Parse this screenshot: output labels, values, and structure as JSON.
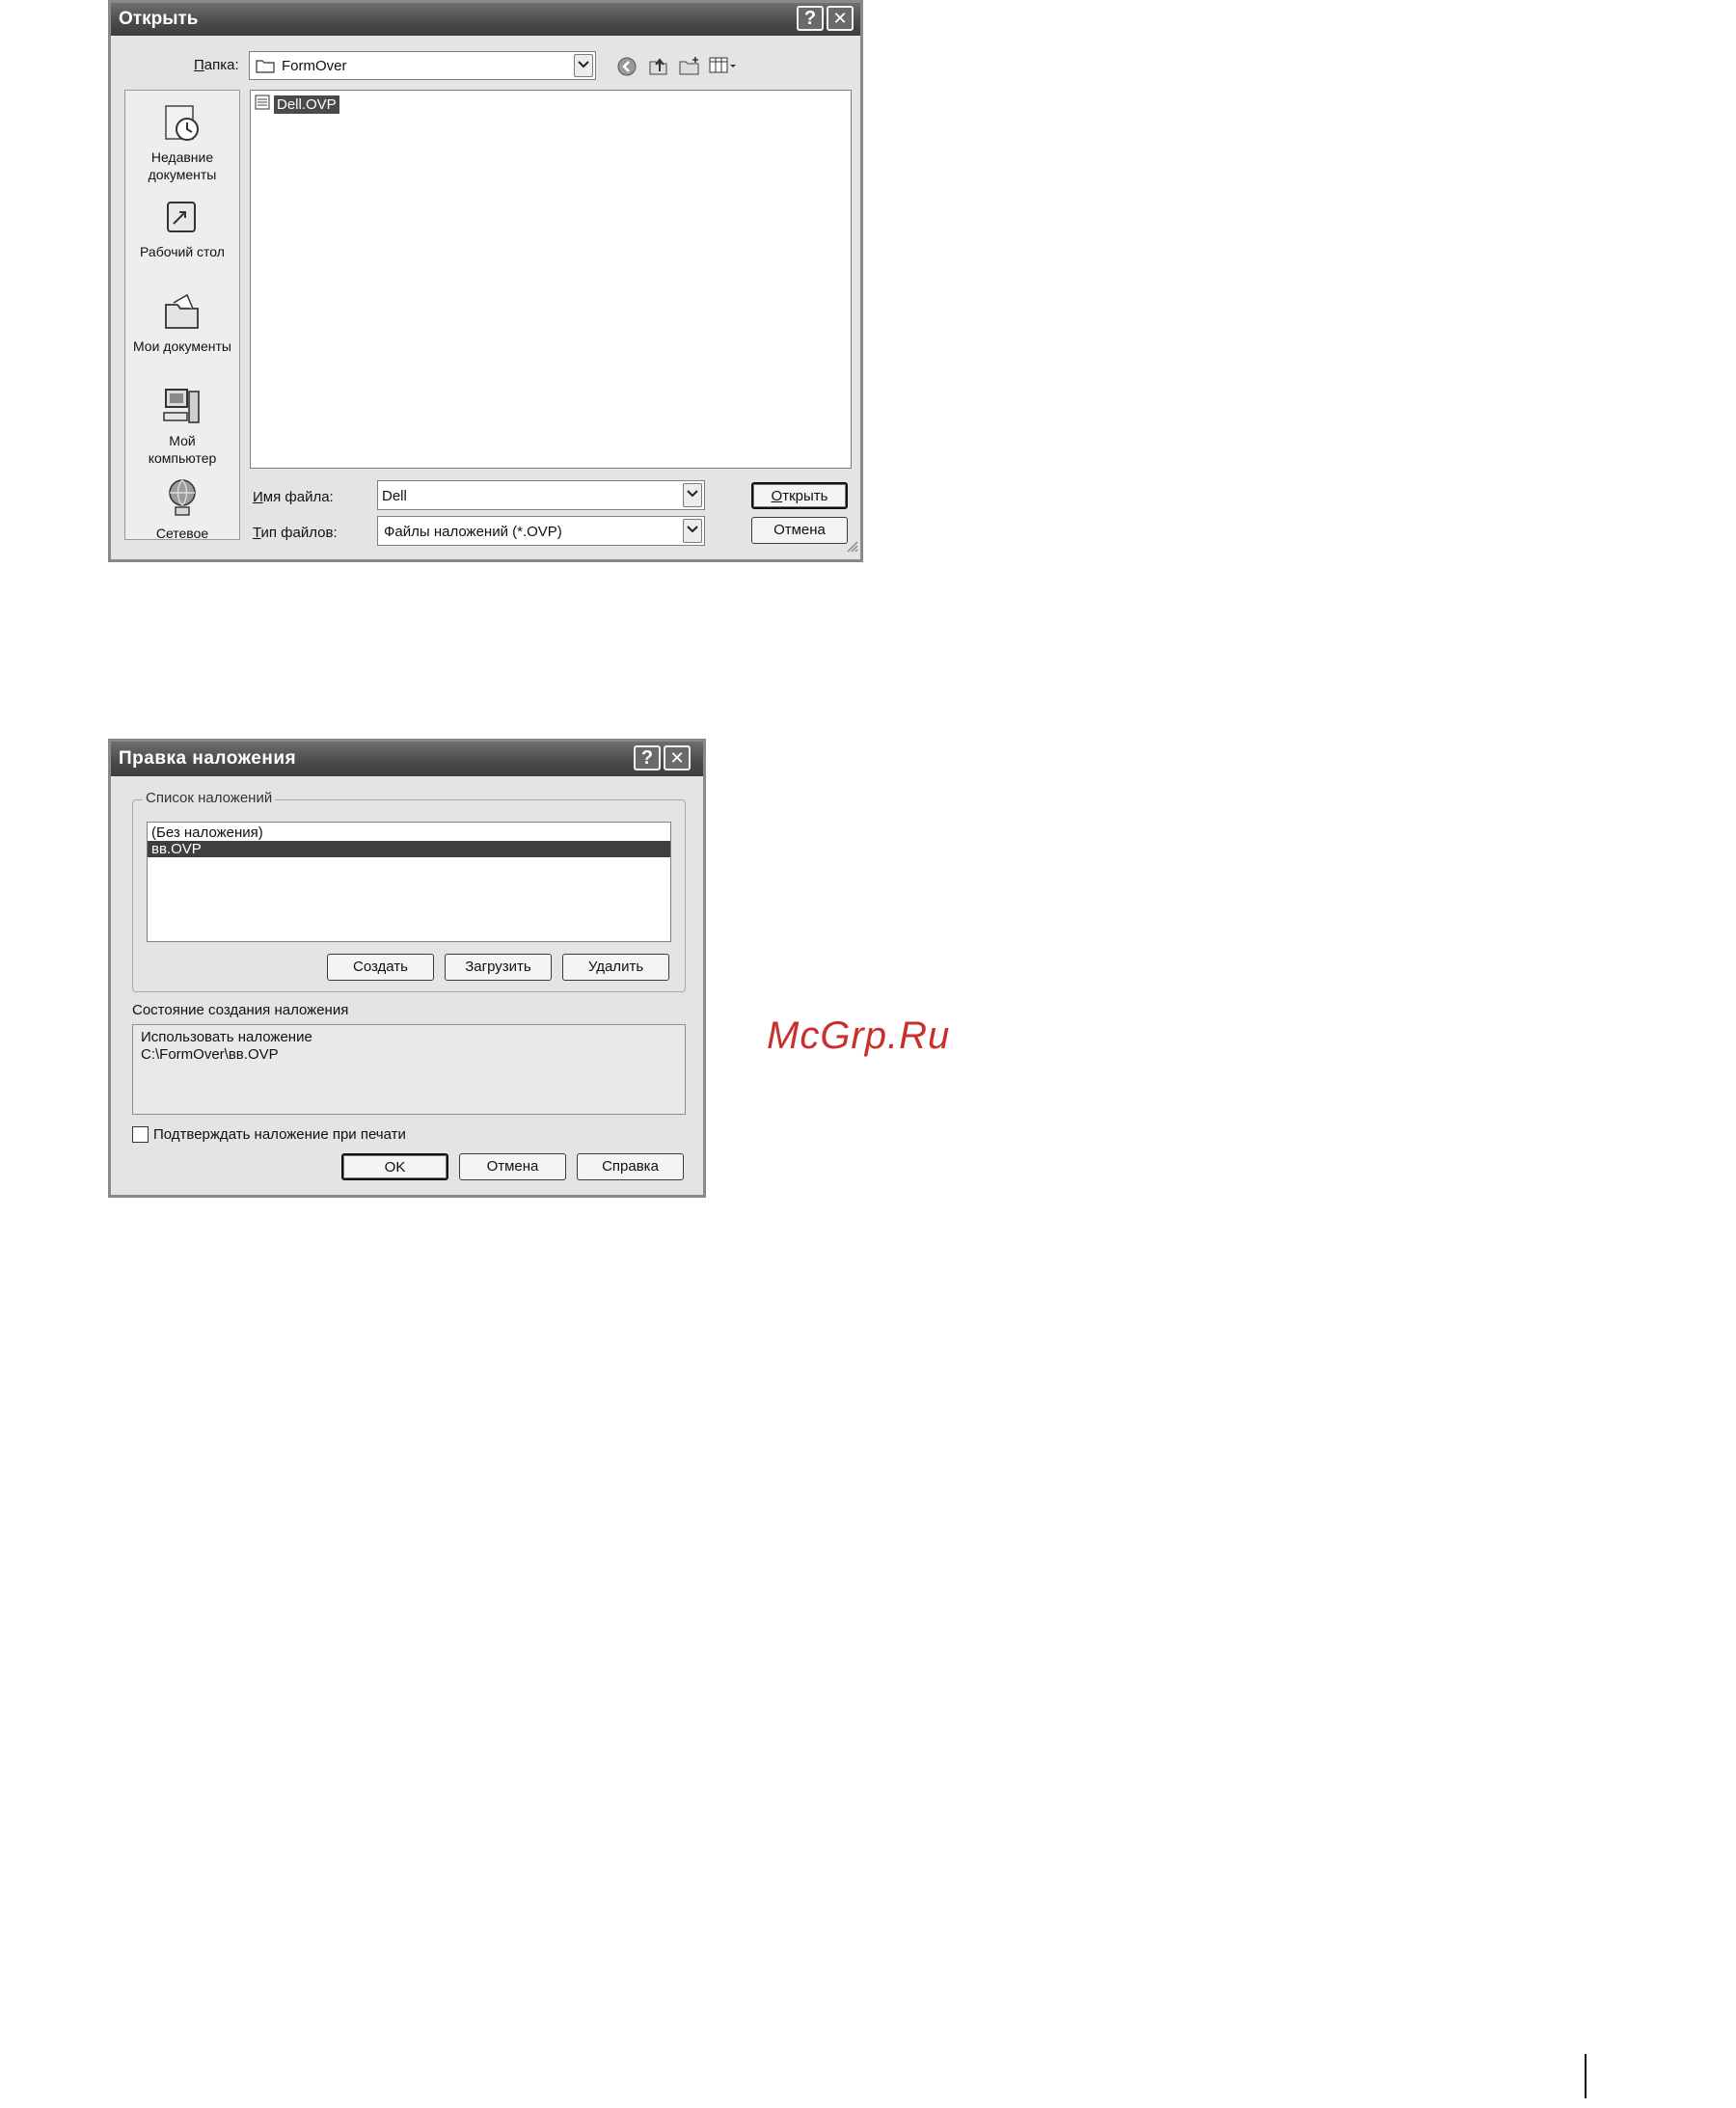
{
  "open_dialog": {
    "title": "Открыть",
    "help_button": "?",
    "close_button": "✕",
    "folder_label": "Папка:",
    "folder_value": "FormOver",
    "places": [
      {
        "line1": "Недавние",
        "line2": "документы",
        "icon": "recent-documents-icon"
      },
      {
        "line1": "Рабочий стол",
        "line2": "",
        "icon": "desktop-icon"
      },
      {
        "line1": "Мои документы",
        "line2": "",
        "icon": "my-documents-icon"
      },
      {
        "line1": "Мой",
        "line2": "компьютер",
        "icon": "my-computer-icon"
      },
      {
        "line1": "Сетевое",
        "line2": "",
        "icon": "network-icon"
      }
    ],
    "files": [
      {
        "name": "Dell.OVP",
        "selected": true
      }
    ],
    "filename_label": "Имя файла:",
    "filename_value": "Dell",
    "filetype_label": "Тип файлов:",
    "filetype_value": "Файлы наложений (*.OVP)",
    "open_button": "Открыть",
    "cancel_button": "Отмена"
  },
  "overlay_dialog": {
    "title": "Правка наложения",
    "help_button": "?",
    "close_button": "✕",
    "list_group_label": "Список наложений",
    "list_items": [
      {
        "label": "(Без наложения)",
        "selected": false
      },
      {
        "label": "вв.OVP",
        "selected": true
      }
    ],
    "create_button": "Создать",
    "load_button": "Загрузить",
    "delete_button": "Удалить",
    "status_label": "Состояние создания наложения",
    "status_line1": "Использовать наложение",
    "status_line2": "C:\\FormOver\\вв.OVP",
    "confirm_checkbox_label": "Подтверждать наложение при печати",
    "confirm_checked": false,
    "ok_button": "OK",
    "cancel_button": "Отмена",
    "help_text_button": "Справка"
  },
  "watermark": "McGrp.Ru"
}
